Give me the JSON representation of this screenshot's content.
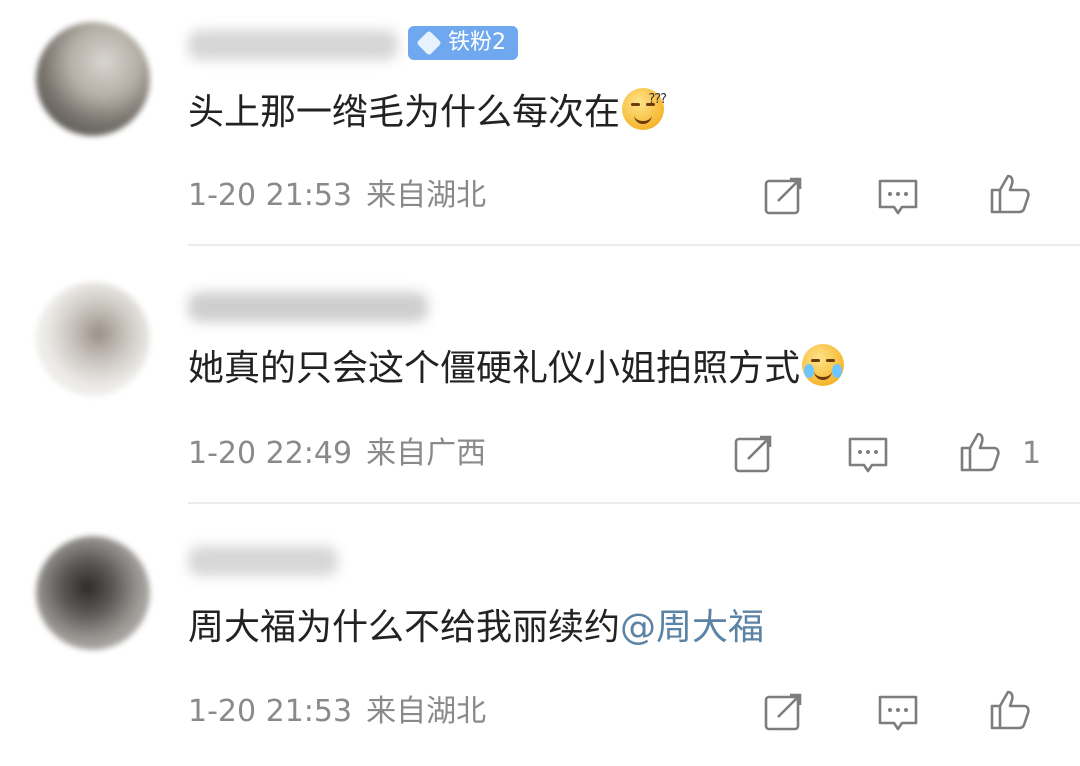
{
  "comments": [
    {
      "badge": "铁粉2",
      "text": "头上那一绺毛为什么每次在",
      "emoji": "thinking-face-emoji",
      "time": "1-20 21:53",
      "location": "来自湖北",
      "like_count": ""
    },
    {
      "badge": "",
      "text": "她真的只会这个僵硬礼仪小姐拍照方式",
      "emoji": "laughing-crying-emoji",
      "time": "1-20 22:49",
      "location": "来自广西",
      "like_count": "1"
    },
    {
      "badge": "",
      "text": "周大福为什么不给我丽续约",
      "mention": "@周大福",
      "time": "1-20 21:53",
      "location": "来自湖北",
      "like_count": ""
    }
  ],
  "icons": {
    "share": "share-icon",
    "reply": "comment-icon",
    "like": "thumbs-up-icon"
  },
  "colors": {
    "text": "#222222",
    "meta": "#8a8a8a",
    "mention": "#5a83a6",
    "badge": "#6fa8ef",
    "divider": "#ececec"
  }
}
